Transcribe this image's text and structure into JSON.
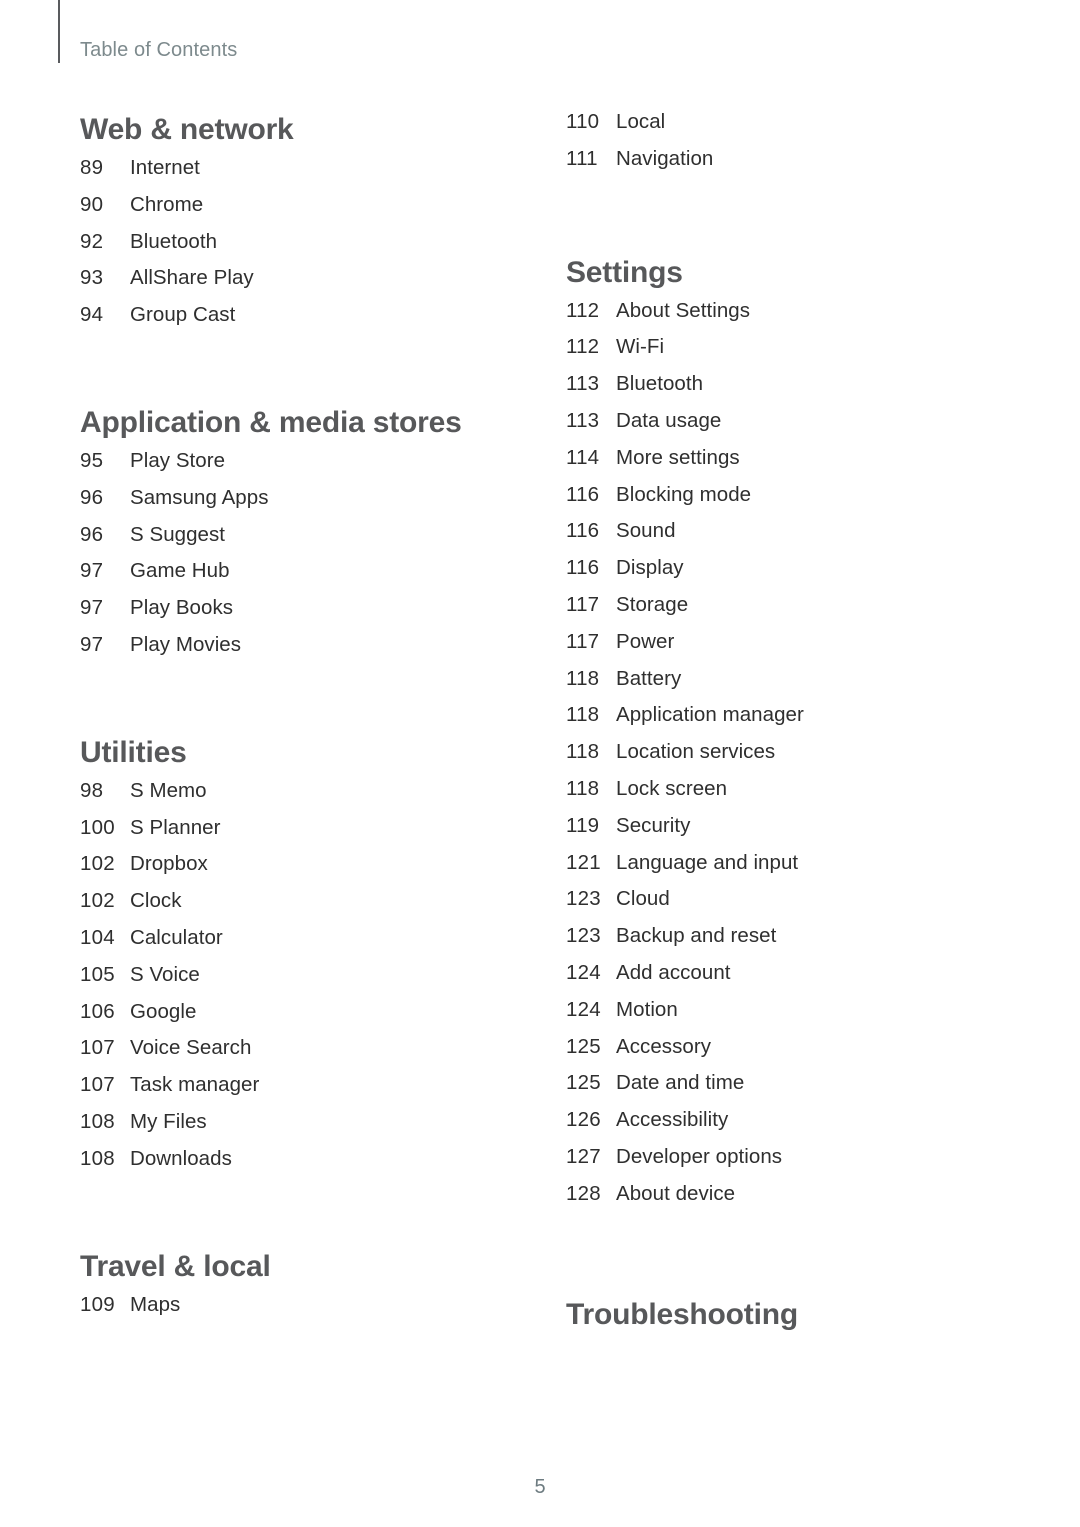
{
  "header": {
    "title": "Table of Contents",
    "rule_color": "#595b5e",
    "title_color": "#7d8a8d"
  },
  "colors": {
    "heading": "#57585a",
    "entry": "#2f2f2f",
    "folio": "#6d7b80"
  },
  "columns": [
    {
      "name": "left",
      "sections": [
        {
          "heading": "Web & network",
          "entries": [
            {
              "page": "89",
              "label": "Internet"
            },
            {
              "page": "90",
              "label": "Chrome"
            },
            {
              "page": "92",
              "label": "Bluetooth"
            },
            {
              "page": "93",
              "label": "AllShare Play"
            },
            {
              "page": "94",
              "label": "Group Cast"
            }
          ]
        },
        {
          "heading": "Application & media stores",
          "entries": [
            {
              "page": "95",
              "label": "Play Store"
            },
            {
              "page": "96",
              "label": "Samsung Apps"
            },
            {
              "page": "96",
              "label": "S Suggest"
            },
            {
              "page": "97",
              "label": "Game Hub"
            },
            {
              "page": "97",
              "label": "Play Books"
            },
            {
              "page": "97",
              "label": "Play Movies"
            }
          ]
        },
        {
          "heading": "Utilities",
          "entries": [
            {
              "page": "98",
              "label": "S Memo"
            },
            {
              "page": "100",
              "label": "S Planner"
            },
            {
              "page": "102",
              "label": "Dropbox"
            },
            {
              "page": "102",
              "label": "Clock"
            },
            {
              "page": "104",
              "label": "Calculator"
            },
            {
              "page": "105",
              "label": "S Voice"
            },
            {
              "page": "106",
              "label": "Google"
            },
            {
              "page": "107",
              "label": "Voice Search"
            },
            {
              "page": "107",
              "label": "Task manager"
            },
            {
              "page": "108",
              "label": "My Files"
            },
            {
              "page": "108",
              "label": "Downloads"
            }
          ]
        },
        {
          "heading": "Travel & local",
          "entries": [
            {
              "page": "109",
              "label": "Maps"
            }
          ]
        }
      ]
    },
    {
      "name": "right",
      "sections": [
        {
          "heading": "",
          "entries": [
            {
              "page": "110",
              "label": "Local"
            },
            {
              "page": "111",
              "label": "Navigation"
            }
          ]
        },
        {
          "heading": "Settings",
          "entries": [
            {
              "page": "112",
              "label": "About Settings"
            },
            {
              "page": "112",
              "label": "Wi-Fi"
            },
            {
              "page": "113",
              "label": "Bluetooth"
            },
            {
              "page": "113",
              "label": "Data usage"
            },
            {
              "page": "114",
              "label": "More settings"
            },
            {
              "page": "116",
              "label": "Blocking mode"
            },
            {
              "page": "116",
              "label": "Sound"
            },
            {
              "page": "116",
              "label": "Display"
            },
            {
              "page": "117",
              "label": "Storage"
            },
            {
              "page": "117",
              "label": "Power"
            },
            {
              "page": "118",
              "label": "Battery"
            },
            {
              "page": "118",
              "label": "Application manager"
            },
            {
              "page": "118",
              "label": "Location services"
            },
            {
              "page": "118",
              "label": "Lock screen"
            },
            {
              "page": "119",
              "label": "Security"
            },
            {
              "page": "121",
              "label": "Language and input"
            },
            {
              "page": "123",
              "label": "Cloud"
            },
            {
              "page": "123",
              "label": "Backup and reset"
            },
            {
              "page": "124",
              "label": "Add account"
            },
            {
              "page": "124",
              "label": "Motion"
            },
            {
              "page": "125",
              "label": "Accessory"
            },
            {
              "page": "125",
              "label": "Date and time"
            },
            {
              "page": "126",
              "label": "Accessibility"
            },
            {
              "page": "127",
              "label": "Developer options"
            },
            {
              "page": "128",
              "label": "About device"
            }
          ]
        },
        {
          "heading": "Troubleshooting",
          "entries": []
        }
      ]
    }
  ],
  "folio": "5"
}
